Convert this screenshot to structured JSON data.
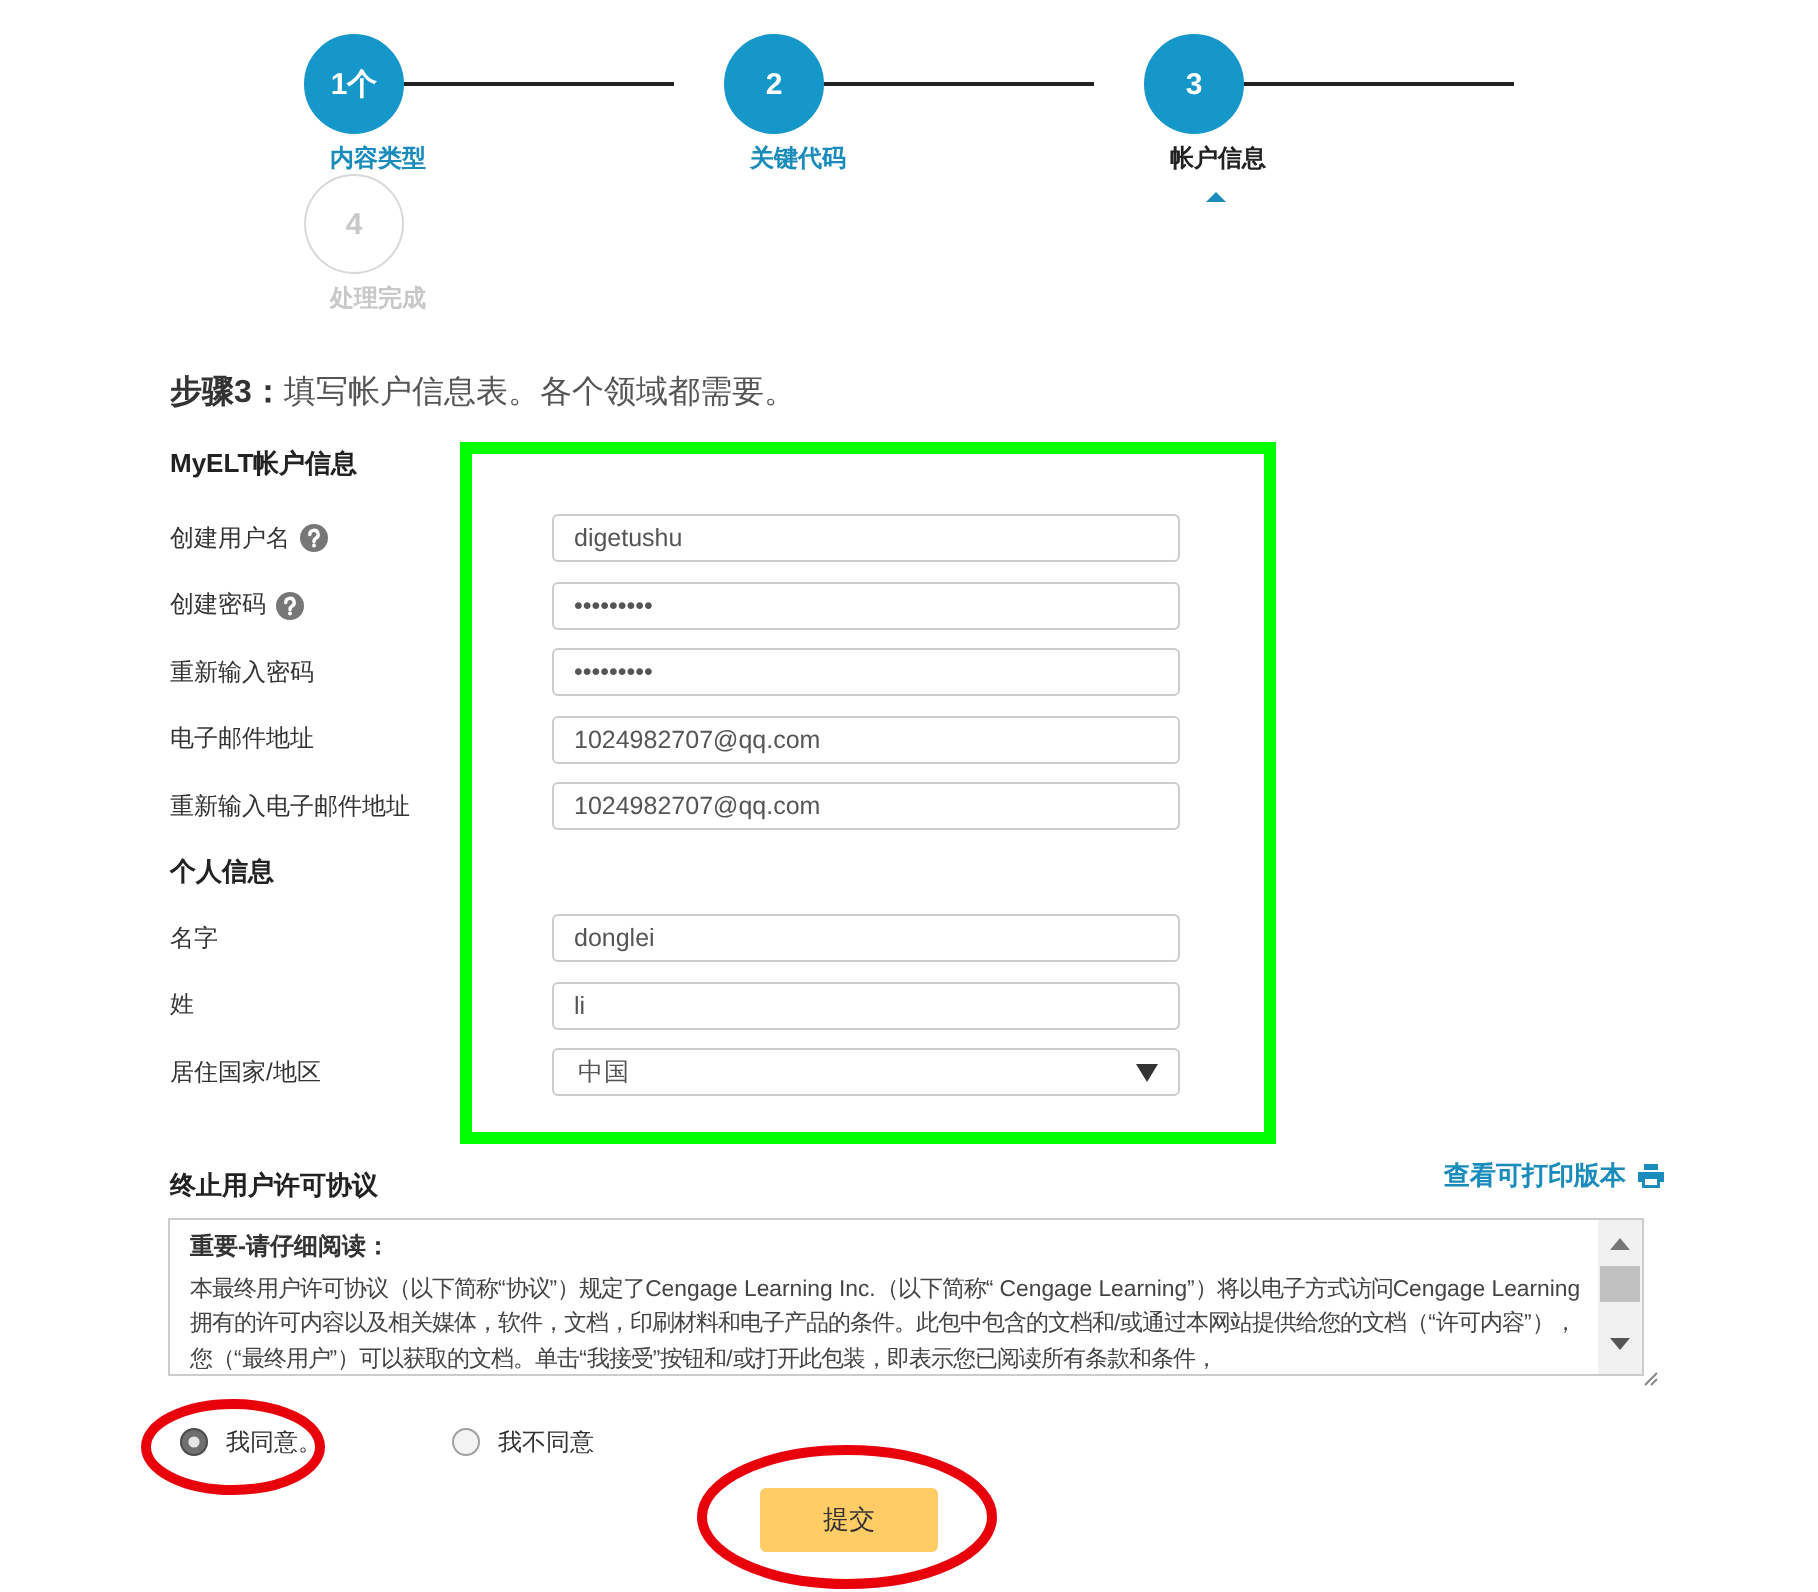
{
  "steps": [
    {
      "number": "1个",
      "label": "内容类型",
      "reached": true,
      "selected": false
    },
    {
      "number": "2",
      "label": "关键代码",
      "reached": true,
      "selected": false
    },
    {
      "number": "3",
      "label": "帐户信息",
      "reached": true,
      "selected": true
    },
    {
      "number": "4",
      "label": "处理完成",
      "reached": false,
      "selected": false
    }
  ],
  "instruction": "**步骤3：**填写帐户信息表。各个领域都需要。",
  "account_form": {
    "highlighted": true,
    "sections": [
      {
        "title": "MyELT帐户信息",
        "fields": [
          {
            "label": "创建用户名",
            "help": true,
            "kind": "text",
            "value": "digetushu"
          },
          {
            "label": "创建密码",
            "help": true,
            "kind": "text",
            "value": "•••••••••"
          },
          {
            "label": "重新输入密码",
            "help": false,
            "kind": "text",
            "value": "•••••••••"
          },
          {
            "label": "电子邮件地址",
            "help": false,
            "kind": "text",
            "value": "1024982707@qq.com"
          },
          {
            "label": "重新输入电子邮件地址",
            "help": false,
            "kind": "text",
            "value": "1024982707@qq.com"
          }
        ]
      },
      {
        "title": "个人信息",
        "fields": [
          {
            "label": "名字",
            "help": false,
            "kind": "text",
            "value": "donglei"
          },
          {
            "label": "姓",
            "help": false,
            "kind": "text",
            "value": "li"
          },
          {
            "label": "居住国家/地区",
            "help": false,
            "kind": "select",
            "value": "中国"
          }
        ]
      }
    ]
  },
  "license": {
    "title": "终止用户许可协议",
    "print_link": "查看可打印版本",
    "heading": "重要-请仔细阅读：",
    "text": "本最终用户许可协议（以下简称“协议”）规定了Cengage Learning Inc.（以下简称“ Cengage Learning”）将以电子方式访问Cengage Learning拥有的许可内容以及相关媒体，软件，文档，印刷材料和电子产品的条件。此包中包含的文档和/或通过本网站提供给您的文档（“许可内容”），您（“最终用户”）可以获取的文档。单击“我接受”按钮和/或打开此包装，即表示您已阅读所有条款和条件，"
  },
  "consent": {
    "options": [
      {
        "label": "我同意。",
        "selected": true,
        "circled": true
      },
      {
        "label": "我不同意",
        "selected": false,
        "circled": false
      }
    ]
  },
  "submit": {
    "label": "提交",
    "circled": true
  }
}
